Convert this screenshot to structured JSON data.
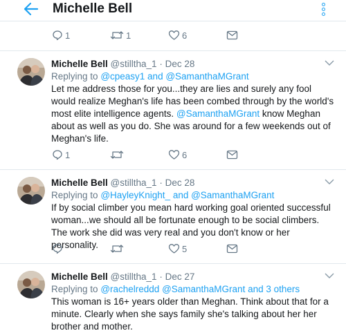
{
  "header": {
    "title": "Michelle Bell"
  },
  "colors": {
    "accent": "#1da1f2",
    "muted": "#657786",
    "text": "#14171a",
    "divider": "#e1e8ed"
  },
  "top_actions": {
    "replies": "1",
    "retweets": "1",
    "likes": "6"
  },
  "tweets": [
    {
      "name": "Michelle Bell",
      "handle": "@stilltha_1",
      "dot": "·",
      "date": "Dec 28",
      "replying_prefix": "Replying to",
      "replying_handles": "@cpeasy1 and @SamanthaMGrant",
      "text_part1": "Let me address those for you...they are lies and surely any fool would realize Meghan's life has been combed through by the world's most elite intelligence agents.",
      "text_mention": "@SamanthaMGrant",
      "text_part2": "know Meghan about as well as you do. She was around for a few weekends out of Meghan's life.",
      "replies": "1",
      "retweets": "",
      "likes": "6"
    },
    {
      "name": "Michelle Bell",
      "handle": "@stilltha_1",
      "dot": "·",
      "date": "Dec 28",
      "replying_prefix": "Replying to",
      "replying_handles": "@HayleyKnight_ and @SamanthaMGrant",
      "text": "If by social climber you mean hard working goal oriented successful woman...we should all be fortunate enough to be social climbers. The work she did was very real and you don't know or her personality.",
      "replies": "",
      "retweets": "",
      "likes": "5"
    },
    {
      "name": "Michelle Bell",
      "handle": "@stilltha_1",
      "dot": "·",
      "date": "Dec 27",
      "replying_prefix": "Replying to",
      "replying_handles": "@rachelreddd @SamanthaMGrant and 3 others",
      "text": "This woman is 16+ years older than Meghan. Think about that for a minute. Clearly when she says family she's talking about her her brother and mother."
    }
  ]
}
